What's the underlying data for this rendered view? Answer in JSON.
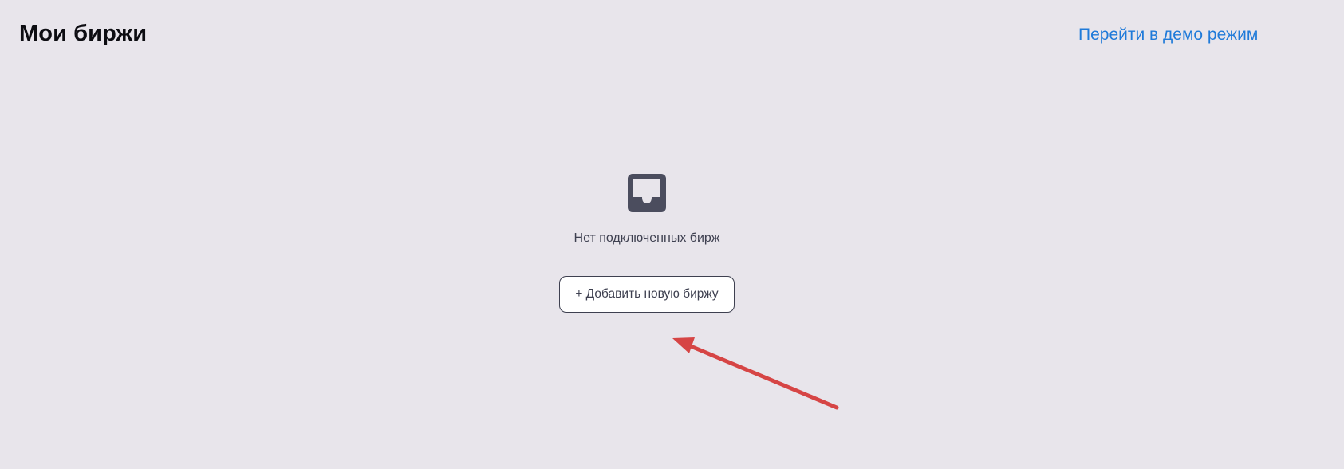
{
  "header": {
    "title": "Мои биржи",
    "demo_link": "Перейти в демо режим"
  },
  "empty_state": {
    "icon": "inbox-icon",
    "message": "Нет подключенных бирж",
    "add_button_label": "+ Добавить новую биржу"
  },
  "annotation": {
    "icon": "arrow-icon",
    "color": "#d64545"
  },
  "colors": {
    "background": "#e8e5eb",
    "link": "#1f7ad9",
    "icon": "#4b4d5e",
    "text": "#3e4050"
  }
}
